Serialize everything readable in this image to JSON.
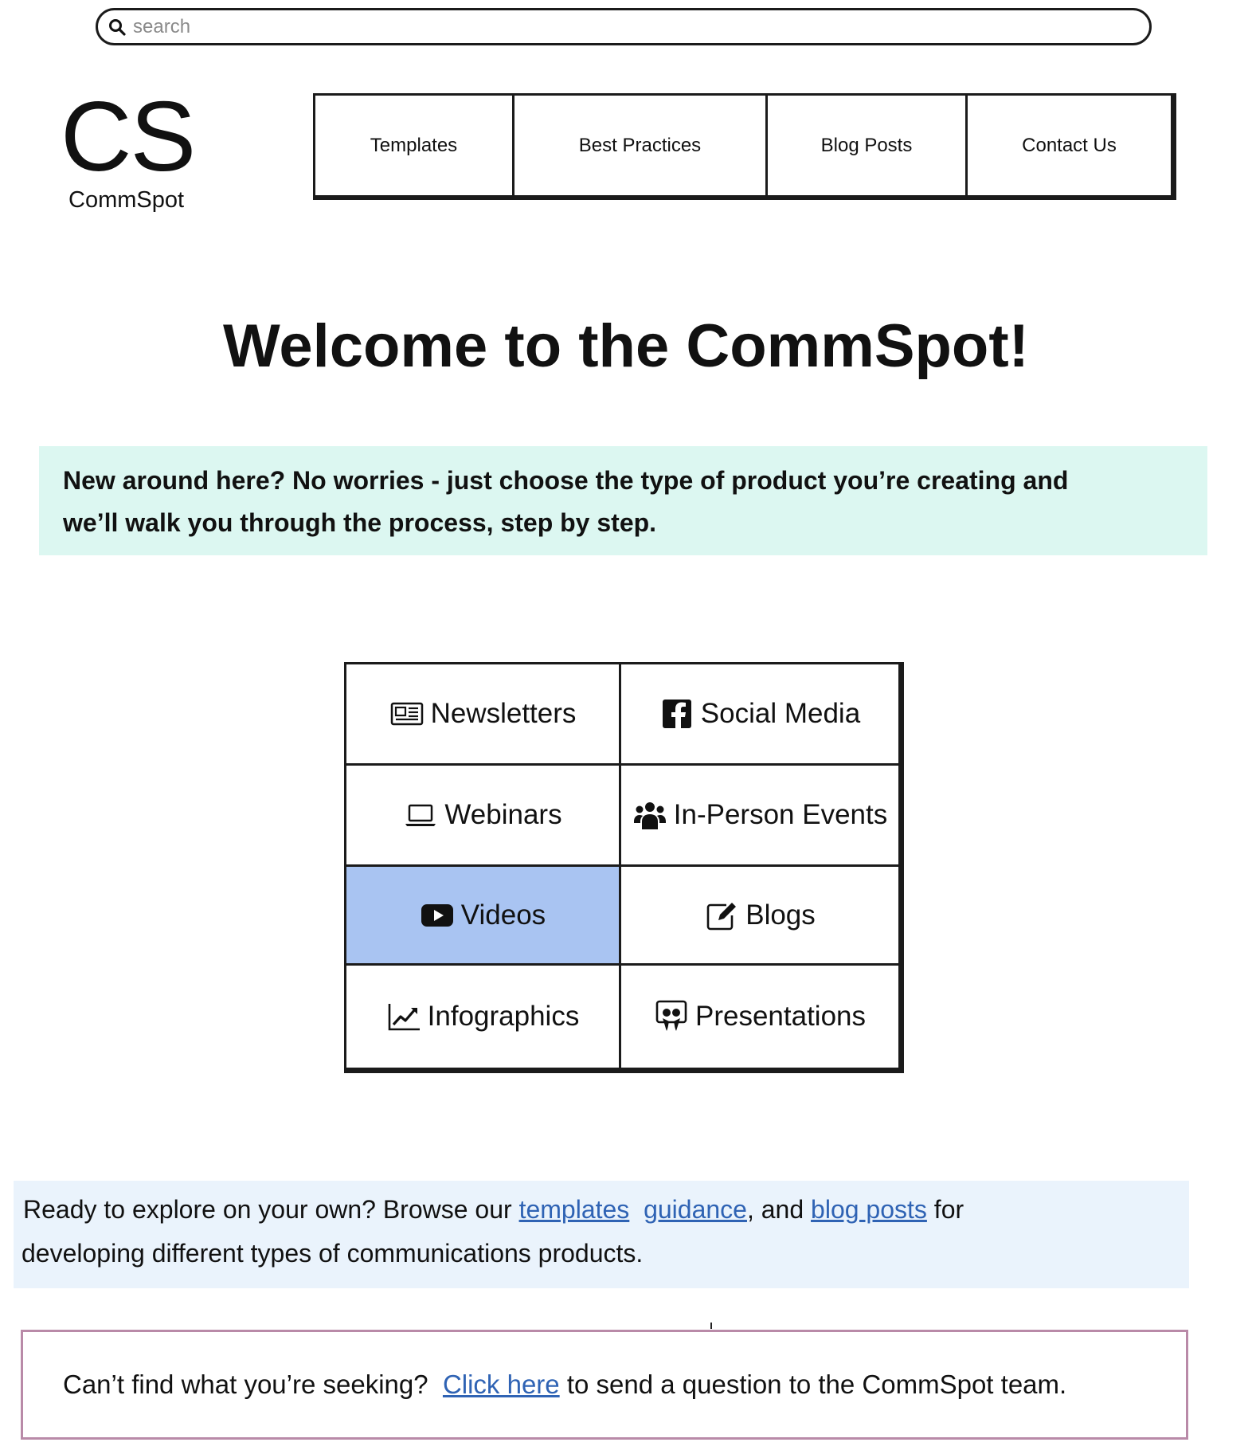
{
  "search": {
    "placeholder": "search",
    "icon": "search-icon"
  },
  "logo": {
    "mark": "CS",
    "name": "CommSpot"
  },
  "nav": {
    "items": [
      {
        "label": "Templates"
      },
      {
        "label": "Best Practices"
      },
      {
        "label": "Blog Posts"
      },
      {
        "label": "Contact Us"
      }
    ]
  },
  "hero": {
    "title": "Welcome to the CommSpot!"
  },
  "intro": {
    "line1": "New around here? No worries - just choose the type of product you’re creating and",
    "line2": "we’ll walk you through the process, step by step.",
    "background": "#dcf7f1"
  },
  "categories": [
    {
      "label": "Newsletters",
      "icon": "newspaper-icon",
      "selected": false
    },
    {
      "label": "Social Media",
      "icon": "facebook-icon",
      "selected": false
    },
    {
      "label": "Webinars",
      "icon": "laptop-icon",
      "selected": false
    },
    {
      "label": "In-Person Events",
      "icon": "people-group-icon",
      "selected": false
    },
    {
      "label": "Videos",
      "icon": "youtube-icon",
      "selected": true
    },
    {
      "label": "Blogs",
      "icon": "edit-icon",
      "selected": false
    },
    {
      "label": "Infographics",
      "icon": "line-chart-icon",
      "selected": false
    },
    {
      "label": "Presentations",
      "icon": "slideshare-icon",
      "selected": false
    }
  ],
  "selected_color": "#a9c4f2",
  "explore": {
    "prefix": "Ready to explore on your own? Browse our ",
    "link_templates": "templates",
    "sep1": "  ",
    "link_guidance": "guidance",
    "mid": ", and ",
    "link_blog": "blog posts",
    "suffix_line1": " for",
    "line2": "developing different types of communications products.",
    "background": "#eaf3fc",
    "link_color": "#2f63b4"
  },
  "question": {
    "prefix": "Can’t find what you’re seeking?  ",
    "link": "Click here",
    "suffix": " to send a question to the CommSpot team.",
    "border_color": "#b98aa8"
  }
}
